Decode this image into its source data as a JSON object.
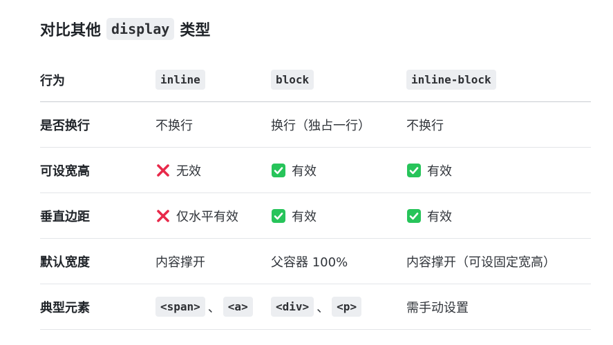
{
  "title": {
    "prefix": "对比其他",
    "code": "display",
    "suffix": "类型"
  },
  "header": {
    "label": "行为",
    "col1": "inline",
    "col2": "block",
    "col3": "inline-block"
  },
  "rows": [
    {
      "label": "是否换行",
      "c1": "不换行",
      "c2": "换行（独占一行）",
      "c3": "不换行"
    },
    {
      "label": "可设宽高",
      "c1": "无效",
      "c2": "有效",
      "c3": "有效"
    },
    {
      "label": "垂直边距",
      "c1": "仅水平有效",
      "c2": "有效",
      "c3": "有效"
    },
    {
      "label": "默认宽度",
      "c1": "内容撑开",
      "c2": "父容器 100%",
      "c3": "内容撑开（可设固定宽高）"
    },
    {
      "label": "典型元素",
      "c1a": "<span>",
      "c1sep": "、",
      "c1b": "<a>",
      "c2a": "<div>",
      "c2sep": "、",
      "c2b": "<p>",
      "c3": "需手动设置"
    }
  ],
  "icons": {
    "cross": "cross-mark-icon",
    "check": "check-mark-button-icon"
  },
  "colors": {
    "cross": "#e8294a",
    "check": "#27c45a",
    "code_bg": "#eceef1"
  }
}
